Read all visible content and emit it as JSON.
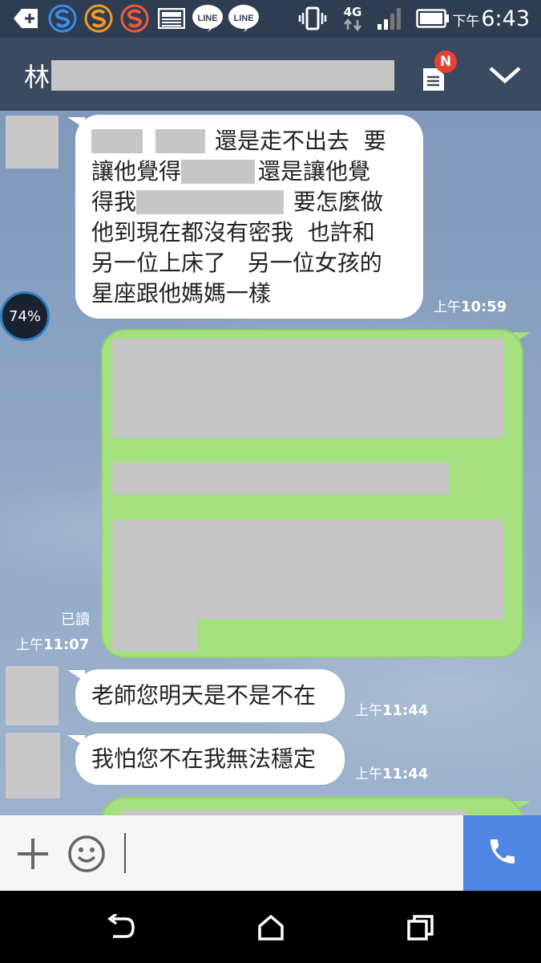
{
  "status_bar": {
    "network": "4G",
    "time_prefix": "下午",
    "time": "6:43",
    "icons": [
      "add-notification-icon",
      "s-app-icon-blue",
      "s-app-icon-orange",
      "s-app-icon-red",
      "image-icon",
      "line-icon",
      "line-icon",
      "vibrate-icon",
      "network-4g-icon",
      "signal-icon",
      "battery-icon"
    ]
  },
  "header": {
    "chat_title_visible": "林",
    "notes_badge": "N"
  },
  "overlay": {
    "battery_widget_percent": "74%"
  },
  "messages": [
    {
      "direction": "incoming",
      "lines_text": [
        "還是走不出去  要",
        "讓他覺得",
        "還是讓他覺",
        "得我",
        "要怎麼做",
        "他到現在都沒有密我  也許和",
        "另一位上床了   另一位女孩的",
        "星座跟他媽媽一樣"
      ],
      "time_prefix": "上午",
      "time": "10:59"
    },
    {
      "direction": "outgoing",
      "text": "",
      "read_label": "已讀",
      "time_prefix": "上午",
      "time": "11:07"
    },
    {
      "direction": "incoming",
      "text": "老師您明天是不是不在",
      "time_prefix": "上午",
      "time": "11:44"
    },
    {
      "direction": "incoming",
      "text": "我怕您不在我無法穩定",
      "time_prefix": "上午",
      "time": "11:44"
    }
  ],
  "input_bar": {
    "icons": [
      "plus-icon",
      "emoji-icon",
      "phone-icon"
    ]
  },
  "nav_bar": {
    "icons": [
      "back-icon",
      "home-icon",
      "recents-icon"
    ]
  },
  "colors": {
    "header_bg": "#3a4a61",
    "outgoing_bubble": "#a4e07e",
    "call_button": "#4f86e4",
    "badge": "#e8412f"
  }
}
